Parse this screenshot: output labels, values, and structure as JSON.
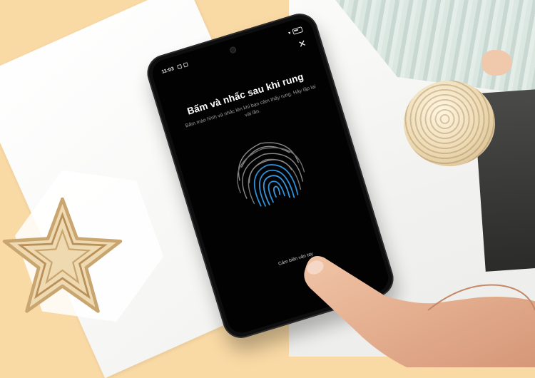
{
  "status_bar": {
    "time": "11:03"
  },
  "enrollment": {
    "title": "Bấm và nhấc sau khi rung",
    "instruction": "Bấm màn hình và nhấc lên khi bạn cảm thấy rung. Hãy lặp lại vài lần.",
    "sensor_label": "Cảm biến vân tay",
    "close_icon": "close-icon",
    "fingerprint_icon": "fingerprint-icon"
  },
  "colors": {
    "screen_bg": "#020202",
    "fingerprint_inner": "#2f8fd6",
    "fingerprint_outer": "#8a8a8a",
    "backdrop": "#f9d9a4"
  }
}
